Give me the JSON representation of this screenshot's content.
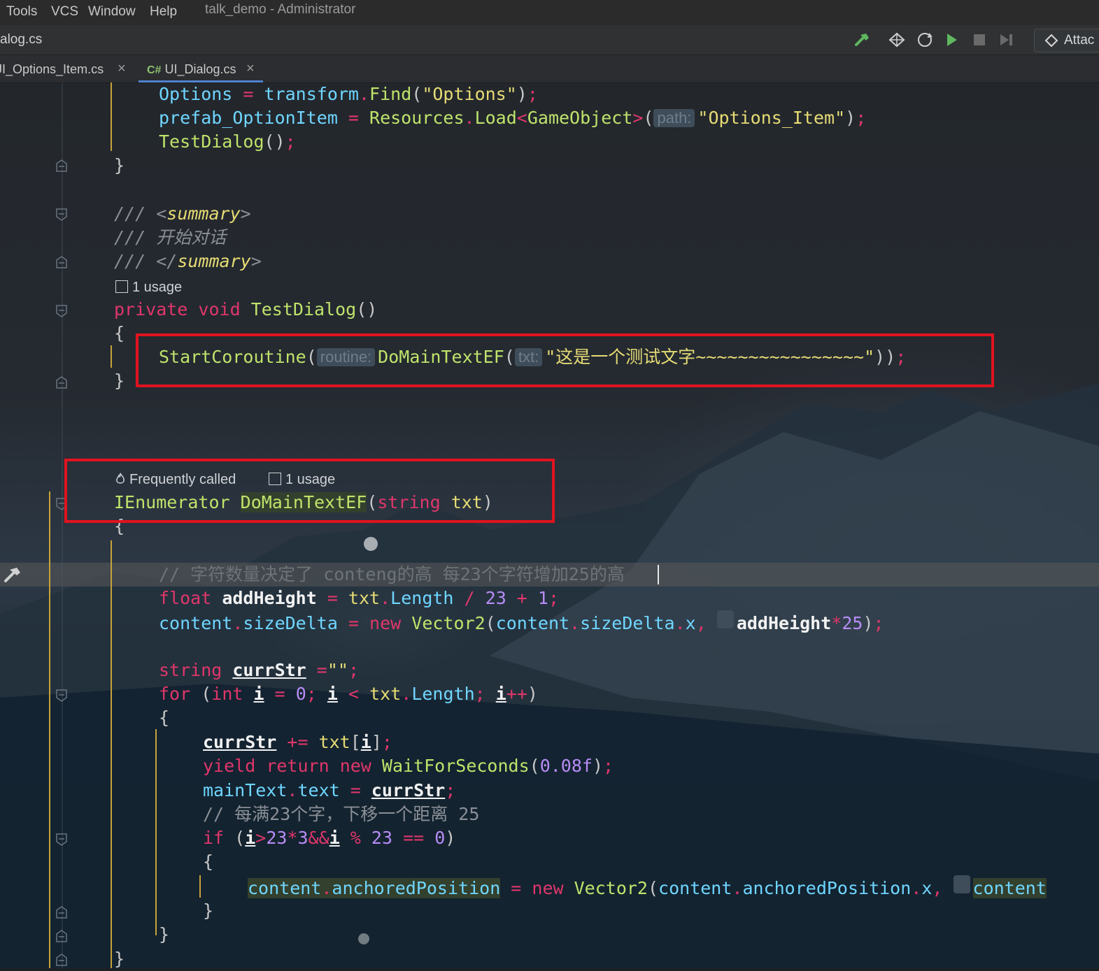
{
  "menu": {
    "items": [
      "Tools",
      "VCS",
      "Window",
      "Help"
    ],
    "window_title": "talk_demo - Administrator"
  },
  "toolbar": {
    "breadcrumb": "alog.cs",
    "attach_label": "Attac",
    "icons": [
      "build-hammer-icon",
      "unity-icon",
      "refresh-unity-icon",
      "run-icon",
      "stop-icon",
      "step-icon",
      "attach-unity-icon"
    ]
  },
  "tabs": [
    {
      "label": "JI_Options_Item.cs",
      "close": "×"
    },
    {
      "lang": "C#",
      "label": "UI_Dialog.cs",
      "close": "×"
    }
  ],
  "code": {
    "l1": {
      "a": "Options",
      "b": " = ",
      "c": "transform",
      "d": ".",
      "e": "Find",
      "f": "(",
      "g": "\"Options\"",
      "h": ")",
      "i": ";"
    },
    "l2": {
      "a": "prefab_OptionItem",
      "b": " = ",
      "c": "Resources",
      "d": ".",
      "e": "Load",
      "f": "<",
      "g": "GameObject",
      "h": ">",
      "i": "(",
      "hint": "path:",
      "j": "\"Options_Item\"",
      "k": ")",
      "l": ";"
    },
    "l3": {
      "a": "TestDialog",
      "b": "()",
      "c": ";"
    },
    "l4": "}",
    "l5": {
      "a": "/// ",
      "b": "<",
      "c": "summary",
      "d": ">"
    },
    "l6": {
      "a": "/// ",
      "b": "开始对话"
    },
    "l7": {
      "a": "/// ",
      "b": "</",
      "c": "summary",
      "d": ">"
    },
    "usage1": "1 usage",
    "l8": {
      "a": "private",
      "b": " ",
      "c": "void",
      "d": " ",
      "e": "TestDialog",
      "f": "()"
    },
    "l9": "{",
    "l10": {
      "a": "StartCoroutine",
      "b": "(",
      "hint1": "routine:",
      "c": "DoMainTextEF",
      "d": "(",
      "hint2": "txt:",
      "e": "\"这是一个测试文字~~~~~~~~~~~~~~~~\"",
      "f": "))",
      "g": ";"
    },
    "l11": "}",
    "freq": "Frequently called",
    "usage2": "1 usage",
    "l12": {
      "a": "IEnumerator",
      "b": " ",
      "c": "DoMainTextEF",
      "d": "(",
      "e": "string",
      "f": " ",
      "g": "txt",
      "h": ")"
    },
    "l13": "{",
    "l14": "// 字符数量决定了 conteng的高 每23个字符增加25的高",
    "l15": {
      "a": "float",
      "b": " ",
      "c": "addHeight",
      "d": " = ",
      "e": "txt",
      "f": ".",
      "g": "Length",
      "h": " / ",
      "i": "23",
      "j": " + ",
      "k": "1",
      "l": ";"
    },
    "l16": {
      "a": "content",
      "b": ".",
      "c": "sizeDelta",
      "d": " = ",
      "e": "new",
      "f": " ",
      "g": "Vector2",
      "h": "(",
      "i": "content",
      "j": ".",
      "k": "sizeDelta",
      "l": ".",
      "m": "x",
      "n": ", ",
      "o": "addHeight",
      "p": "*",
      "q": "25",
      "r": ")",
      "s": ";"
    },
    "l17": {
      "a": "string",
      "b": " ",
      "c": "currStr",
      "d": " =",
      "e": "\"\"",
      "f": ";"
    },
    "l18": {
      "a": "for",
      "b": " (",
      "c": "int",
      "d": " ",
      "e": "i",
      "f": " = ",
      "g": "0",
      "h": "; ",
      "i": "i",
      "j": " < ",
      "k": "txt",
      "l": ".",
      "m": "Length",
      "n": "; ",
      "o": "i",
      "p": "++",
      "q": ")"
    },
    "l19": "{",
    "l20": {
      "a": "currStr",
      "b": " += ",
      "c": "txt",
      "d": "[",
      "e": "i",
      "f": "]",
      "g": ";"
    },
    "l21": {
      "a": "yield",
      "b": " ",
      "c": "return",
      "d": " ",
      "e": "new",
      "f": " ",
      "g": "WaitForSeconds",
      "h": "(",
      "i": "0.08f",
      "j": ")",
      "k": ";"
    },
    "l22": {
      "a": "mainText",
      "b": ".",
      "c": "text",
      "d": " = ",
      "e": "currStr",
      "f": ";"
    },
    "l23": {
      "a": "// ",
      "b": "每满23个字，下移一个距离 25"
    },
    "l24": {
      "a": "if",
      "b": " (",
      "c": "i",
      "d": ">",
      "e": "23",
      "f": "*",
      "g": "3",
      "h": "&&",
      "i": "i",
      "j": " % ",
      "k": "23",
      "l": " == ",
      "m": "0",
      "n": ")"
    },
    "l25": "{",
    "l26": {
      "a": "content",
      "b": ".",
      "c": "anchoredPosition",
      "d": " = ",
      "e": "new",
      "f": " ",
      "g": "Vector2",
      "h": "(",
      "i": "content",
      "j": ".",
      "k": "anchoredPosition",
      "l": ".",
      "m": "x",
      "n": ", ",
      "o": "content"
    },
    "l27": "}",
    "l28": "}",
    "l29": "}"
  },
  "colors": {
    "keyword": "#e0366b",
    "type": "#bfe36b",
    "property": "#6fd6ff",
    "string": "#e6db74",
    "number": "#b78cf5",
    "comment": "#8a8f96",
    "annotation_box": "#e0131f",
    "tab_underline": "#4f83d1"
  }
}
